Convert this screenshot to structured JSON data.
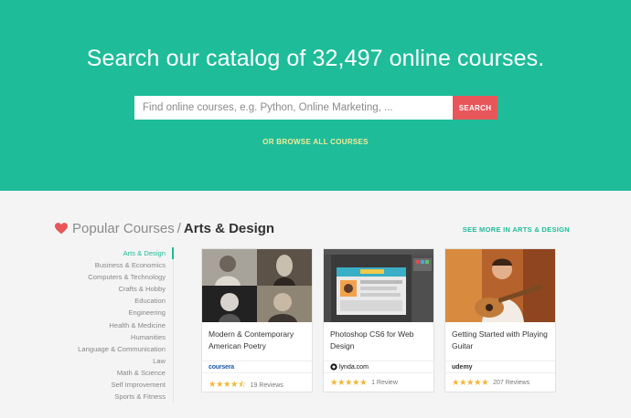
{
  "hero": {
    "title": "Search our catalog of 32,497 online courses.",
    "search_placeholder": "Find online courses, e.g. Python, Online Marketing, ...",
    "search_button": "SEARCH",
    "browse_link": "OR BROWSE ALL COURSES"
  },
  "section": {
    "title_prefix": "Popular Courses",
    "separator": "/",
    "category": "Arts & Design",
    "see_more": "SEE MORE IN ARTS & DESIGN"
  },
  "categories": [
    "Arts & Design",
    "Business & Economics",
    "Computers & Technology",
    "Crafts & Hobby",
    "Education",
    "Engineering",
    "Health & Medicine",
    "Humanities",
    "Language & Communication",
    "Law",
    "Math & Science",
    "Self Improvement",
    "Sports & Fitness"
  ],
  "active_category": "Arts & Design",
  "courses": [
    {
      "title": "Modern & Contemporary American Poetry",
      "provider": "coursera",
      "stars": "★★★★⯪",
      "rating": 4.5,
      "reviews": "19 Reviews"
    },
    {
      "title": "Photoshop CS6 for Web Design",
      "provider": "lynda.com",
      "stars": "★★★★★",
      "rating": 5,
      "reviews": "1 Review"
    },
    {
      "title": "Getting Started with Playing Guitar",
      "provider": "udemy",
      "stars": "★★★★★",
      "rating": 5,
      "reviews": "207 Reviews"
    }
  ],
  "colors": {
    "hero_bg": "#1ebc99",
    "search_button": "#e8565a",
    "browse_link": "#f4eb9a",
    "accent": "#1ebc99",
    "star": "#f2b63a"
  }
}
